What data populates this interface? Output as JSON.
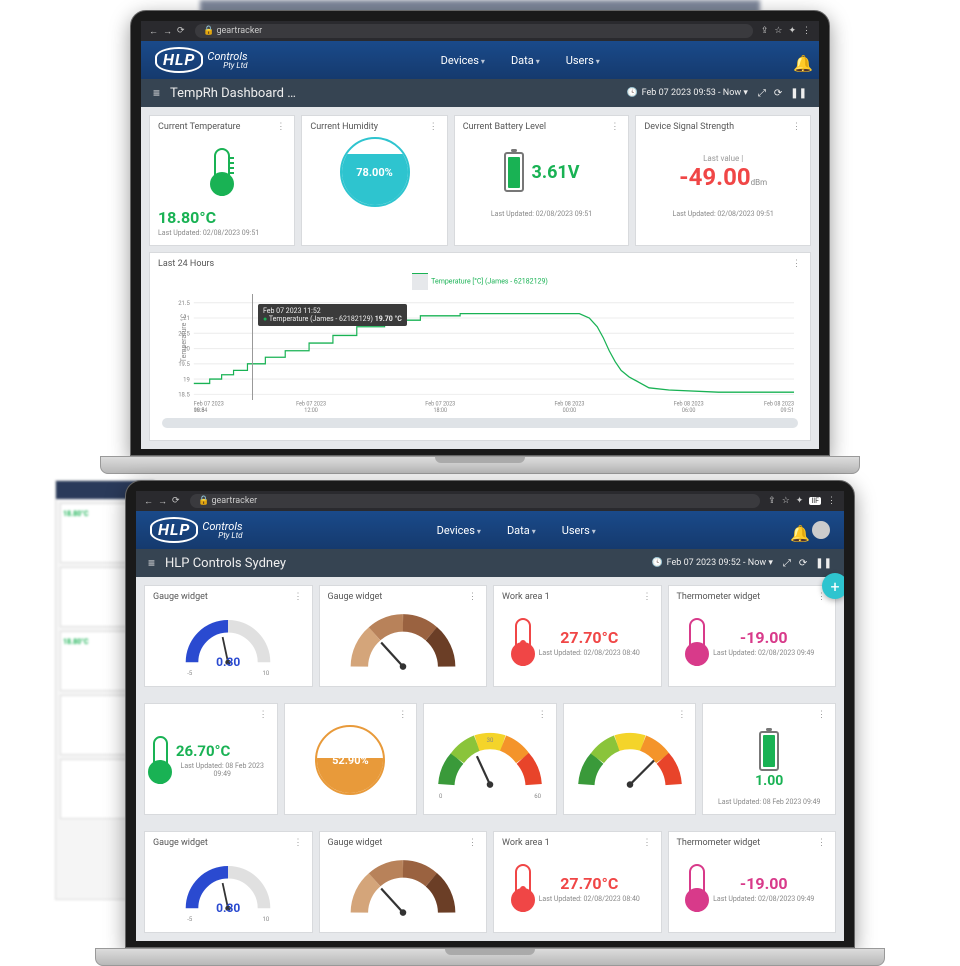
{
  "browser": {
    "url": "🔒 geartracker",
    "ext_label": "IIF"
  },
  "app": {
    "brand_l1": "HLP",
    "brand_l2": "Controls",
    "brand_l3": "Pty Ltd",
    "menu": [
      "Devices",
      "Data",
      "Users"
    ]
  },
  "top": {
    "title": "TempRh Dashboard …",
    "range": "Feb 07 2023 09:53 - Now ▾",
    "cards": {
      "temp": {
        "title": "Current Temperature",
        "value": "18.80°C",
        "updated": "Last Updated: 02/08/2023 09:51"
      },
      "hum": {
        "title": "Current Humidity",
        "value": "78.00%",
        "fill": 78
      },
      "bat": {
        "title": "Current Battery Level",
        "value": "3.61V",
        "updated": "Last Updated: 02/08/2023 09:51",
        "fill": 85,
        "color": "#19b254"
      },
      "sig": {
        "title": "Device Signal Strength",
        "label": "Last value |",
        "value": "-49.00",
        "unit": "dBm",
        "updated": "Last Updated: 02/08/2023 09:51"
      }
    },
    "chart": {
      "title": "Last 24 Hours",
      "legend": "Temperature [°C] (James - 62182129)",
      "ylabel": "Temperature °C",
      "tooltip_time": "Feb 07 2023 11:52",
      "tooltip_series": "Temperature (James - 62182129) ",
      "tooltip_val": "19.70 °C"
    }
  },
  "bottom": {
    "title": "HLP Controls Sydney",
    "range": "Feb 07 2023 09:52 - Now ▾",
    "row1": [
      {
        "title": "Gauge widget",
        "value": "0.30",
        "min": "-5",
        "max": "10",
        "type": "gauge-blue"
      },
      {
        "title": "Gauge widget",
        "type": "gauge-brown"
      },
      {
        "title": "Work area 1",
        "value": "27.70°C",
        "updated": "Last Updated: 02/08/2023 08:40",
        "type": "temp-red"
      },
      {
        "title": "Thermometer widget",
        "value": "-19.00",
        "updated": "Last Updated: 02/08/2023 09:49",
        "type": "temp-pink"
      }
    ],
    "row2": [
      {
        "title": "",
        "value": "26.70°C",
        "updated": "Last Updated: 08 Feb 2023 09:49",
        "type": "temp-green"
      },
      {
        "title": "",
        "value": "52.90%",
        "type": "liquid-orange",
        "fill": 53
      },
      {
        "title": "",
        "type": "gauge-rainbow",
        "needle": -20
      },
      {
        "title": "",
        "type": "gauge-rainbow",
        "needle": 40
      },
      {
        "title": "",
        "value": "1.00",
        "updated": "Last Updated: 08 Feb 2023 09:49",
        "type": "battery",
        "fill": 90
      }
    ],
    "row3": [
      {
        "title": "Gauge widget",
        "value": "0.30",
        "min": "-5",
        "max": "10",
        "type": "gauge-blue"
      },
      {
        "title": "Gauge widget",
        "type": "gauge-brown"
      },
      {
        "title": "Work area 1",
        "value": "27.70°C",
        "updated": "Last Updated: 02/08/2023 08:40",
        "type": "temp-red"
      },
      {
        "title": "Thermometer widget",
        "value": "-19.00",
        "updated": "Last Updated: 02/08/2023 09:49",
        "type": "temp-pink"
      }
    ]
  },
  "chart_data": {
    "type": "line",
    "title": "Last 24 Hours",
    "xlabel": "",
    "ylabel": "Temperature °C",
    "ylim": [
      18.5,
      21.5
    ],
    "yticks": [
      18.5,
      19,
      19.5,
      20,
      20.5,
      21,
      21.5
    ],
    "x_categories": [
      "Feb 07 2023 09:54",
      "Feb 07 2023 12:00",
      "Feb 07 2023 18:00",
      "Feb 08 2023 00:00",
      "Feb 08 2023 06:00",
      "Feb 08 2023 09:51"
    ],
    "series": [
      {
        "name": "Temperature [°C] (James - 62182129)",
        "x": [
          0,
          0.04,
          0.08,
          0.1,
          0.13,
          0.17,
          0.22,
          0.26,
          0.31,
          0.36,
          0.4,
          0.46,
          0.52,
          0.58,
          0.64,
          0.68,
          0.7,
          0.72,
          0.74,
          0.76,
          0.78,
          0.8,
          0.82,
          0.85,
          0.88,
          0.92,
          1.0
        ],
        "y": [
          18.8,
          19.0,
          19.2,
          19.4,
          19.6,
          19.8,
          20.1,
          20.4,
          20.6,
          20.8,
          21.0,
          21.1,
          21.2,
          21.2,
          21.2,
          21.2,
          21.0,
          20.6,
          20.2,
          19.8,
          19.4,
          19.2,
          19.0,
          18.8,
          18.7,
          18.6,
          18.6
        ]
      }
    ],
    "annotations": [
      {
        "x": 0.09,
        "label": "Feb 07 2023 11:52",
        "value": "19.70 °C"
      }
    ]
  },
  "bg": {
    "mini1": "18.80°C",
    "mini2": "18.80°C"
  }
}
